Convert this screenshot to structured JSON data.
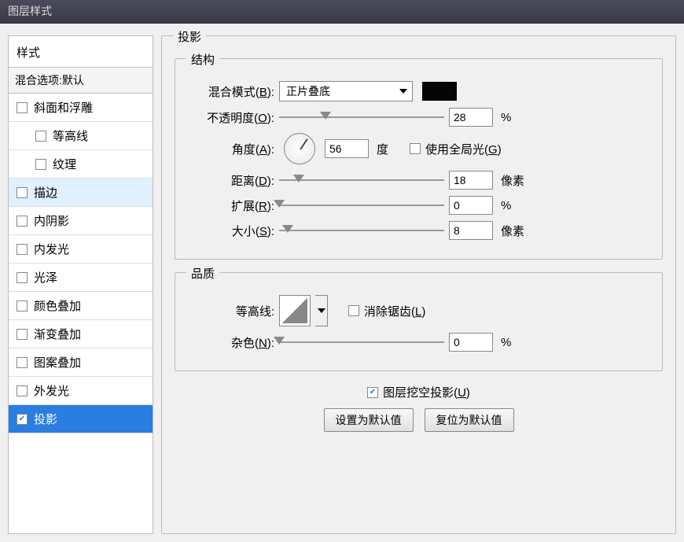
{
  "title": "图层样式",
  "sidebar": {
    "header": "样式",
    "sub": "混合选项:默认",
    "items": [
      {
        "label": "斜面和浮雕",
        "checked": false,
        "indent": false
      },
      {
        "label": "等高线",
        "checked": false,
        "indent": true
      },
      {
        "label": "纹理",
        "checked": false,
        "indent": true
      },
      {
        "label": "描边",
        "checked": false,
        "indent": false,
        "highlight": true
      },
      {
        "label": "内阴影",
        "checked": false,
        "indent": false
      },
      {
        "label": "内发光",
        "checked": false,
        "indent": false
      },
      {
        "label": "光泽",
        "checked": false,
        "indent": false
      },
      {
        "label": "颜色叠加",
        "checked": false,
        "indent": false
      },
      {
        "label": "渐变叠加",
        "checked": false,
        "indent": false
      },
      {
        "label": "图案叠加",
        "checked": false,
        "indent": false
      },
      {
        "label": "外发光",
        "checked": false,
        "indent": false
      },
      {
        "label": "投影",
        "checked": true,
        "indent": false,
        "selected": true
      }
    ]
  },
  "panel": {
    "title": "投影",
    "structure": {
      "title": "结构",
      "blendMode": {
        "label": "混合模式",
        "key": "B",
        "value": "正片叠底",
        "color": "#050505"
      },
      "opacity": {
        "label": "不透明度",
        "key": "O",
        "value": "28",
        "pos": 28,
        "unit": "%"
      },
      "angle": {
        "label": "角度",
        "key": "A",
        "value": "56",
        "unit": "度"
      },
      "useGlobal": {
        "label": "使用全局光",
        "key": "G",
        "checked": false
      },
      "distance": {
        "label": "距离",
        "key": "D",
        "value": "18",
        "pos": 12,
        "unit": "像素"
      },
      "spread": {
        "label": "扩展",
        "key": "R",
        "value": "0",
        "pos": 0,
        "unit": "%"
      },
      "size": {
        "label": "大小",
        "key": "S",
        "value": "8",
        "pos": 5,
        "unit": "像素"
      }
    },
    "quality": {
      "title": "品质",
      "contour": {
        "label": "等高线"
      },
      "antialias": {
        "label": "消除锯齿",
        "key": "L",
        "checked": false
      },
      "noise": {
        "label": "杂色",
        "key": "N",
        "value": "0",
        "pos": 0,
        "unit": "%"
      }
    },
    "knockout": {
      "label": "图层挖空投影",
      "key": "U",
      "checked": true
    },
    "buttons": {
      "setDefault": "设置为默认值",
      "resetDefault": "复位为默认值"
    }
  }
}
